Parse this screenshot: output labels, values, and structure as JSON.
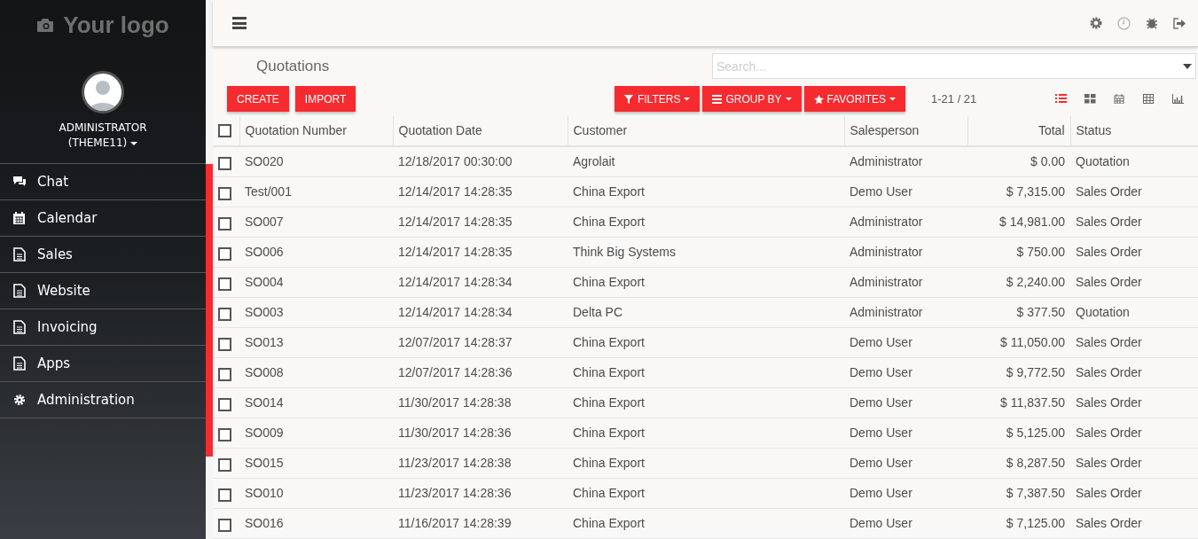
{
  "sidebar": {
    "logo": "Your logo",
    "user": {
      "name": "ADMINISTRATOR",
      "company": "(THEME11)"
    },
    "items": [
      {
        "label": "Chat",
        "kind": "chat"
      },
      {
        "label": "Calendar",
        "kind": "calendar"
      },
      {
        "label": "Sales",
        "kind": "document"
      },
      {
        "label": "Website",
        "kind": "document"
      },
      {
        "label": "Invoicing",
        "kind": "document"
      },
      {
        "label": "Apps",
        "kind": "document"
      },
      {
        "label": "Administration",
        "kind": "settings"
      }
    ]
  },
  "page": {
    "title": "Quotations",
    "search": {
      "placeholder": "Search..."
    },
    "actions": [
      "CREATE",
      "IMPORT"
    ],
    "search_buttons": [
      {
        "label": "FILTERS",
        "kind": "filter"
      },
      {
        "label": "GROUP BY",
        "kind": "group"
      },
      {
        "label": "FAVORITES",
        "kind": "favorite"
      }
    ],
    "pager": "1-21 / 21",
    "views": [
      {
        "kind": "list",
        "selected": true
      },
      {
        "kind": "kanban",
        "selected": false
      },
      {
        "kind": "calendar",
        "selected": false
      },
      {
        "kind": "pivot",
        "selected": false
      },
      {
        "kind": "graph",
        "selected": false
      }
    ]
  },
  "table": {
    "all_checked": false,
    "columns": [
      "Quotation Number",
      "Quotation Date",
      "Customer",
      "Salesperson",
      "Total",
      "Status"
    ],
    "rows": [
      {
        "cells": [
          "SO020",
          "12/18/2017 00:30:00",
          "Agrolait",
          "Administrator",
          "$ 0.00",
          "Quotation"
        ],
        "checked": false
      },
      {
        "cells": [
          "Test/001",
          "12/14/2017 14:28:35",
          "China Export",
          "Demo User",
          "$ 7,315.00",
          "Sales Order"
        ],
        "checked": false
      },
      {
        "cells": [
          "SO007",
          "12/14/2017 14:28:35",
          "China Export",
          "Administrator",
          "$ 14,981.00",
          "Sales Order"
        ],
        "checked": false
      },
      {
        "cells": [
          "SO006",
          "12/14/2017 14:28:35",
          "Think Big Systems",
          "Administrator",
          "$ 750.00",
          "Sales Order"
        ],
        "checked": false
      },
      {
        "cells": [
          "SO004",
          "12/14/2017 14:28:34",
          "China Export",
          "Administrator",
          "$ 2,240.00",
          "Sales Order"
        ],
        "checked": false
      },
      {
        "cells": [
          "SO003",
          "12/14/2017 14:28:34",
          "Delta PC",
          "Administrator",
          "$ 377.50",
          "Quotation"
        ],
        "checked": false
      },
      {
        "cells": [
          "SO013",
          "12/07/2017 14:28:37",
          "China Export",
          "Demo User",
          "$ 11,050.00",
          "Sales Order"
        ],
        "checked": false
      },
      {
        "cells": [
          "SO008",
          "12/07/2017 14:28:36",
          "China Export",
          "Demo User",
          "$ 9,772.50",
          "Sales Order"
        ],
        "checked": false
      },
      {
        "cells": [
          "SO014",
          "11/30/2017 14:28:38",
          "China Export",
          "Demo User",
          "$ 11,837.50",
          "Sales Order"
        ],
        "checked": false
      },
      {
        "cells": [
          "SO009",
          "11/30/2017 14:28:36",
          "China Export",
          "Demo User",
          "$ 5,125.00",
          "Sales Order"
        ],
        "checked": false
      },
      {
        "cells": [
          "SO015",
          "11/23/2017 14:28:38",
          "China Export",
          "Demo User",
          "$ 8,287.50",
          "Sales Order"
        ],
        "checked": false
      },
      {
        "cells": [
          "SO010",
          "11/23/2017 14:28:36",
          "China Export",
          "Demo User",
          "$ 7,387.50",
          "Sales Order"
        ],
        "checked": false
      },
      {
        "cells": [
          "SO016",
          "11/16/2017 14:28:39",
          "China Export",
          "Demo User",
          "$ 7,125.00",
          "Sales Order"
        ],
        "checked": false
      }
    ]
  }
}
